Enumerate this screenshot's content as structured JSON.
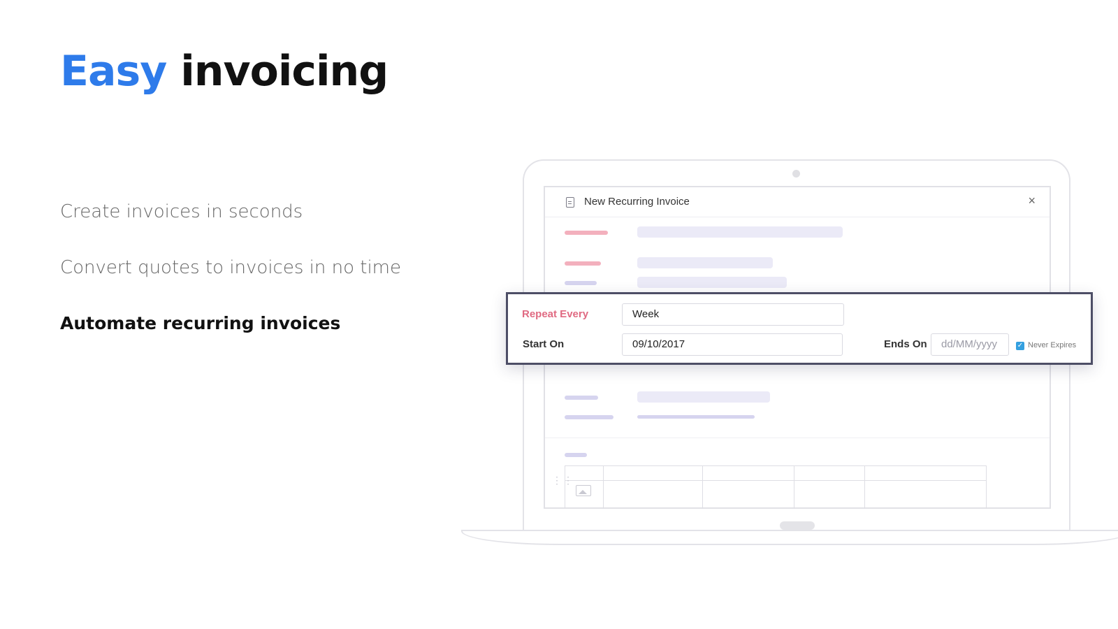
{
  "headline": {
    "accent": "Easy",
    "rest": "invoicing"
  },
  "features": [
    {
      "label": "Create invoices in seconds",
      "active": false
    },
    {
      "label": "Convert quotes to invoices in no time",
      "active": false
    },
    {
      "label": "Automate recurring invoices",
      "active": true
    }
  ],
  "modal": {
    "title": "New Recurring Invoice",
    "close_icon": "close-icon",
    "doc_icon": "document-icon"
  },
  "recurring": {
    "repeat_every_label": "Repeat Every",
    "repeat_every_value": "Week",
    "start_on_label": "Start On",
    "start_on_value": "09/10/2017",
    "ends_on_label": "Ends On",
    "ends_on_placeholder": "dd/MM/yyyy",
    "never_expires_label": "Never Expires",
    "never_expires_checked": true
  },
  "colors": {
    "accent": "#2e7bea",
    "repeat_label": "#e06a82",
    "panel_border": "#4d4e66",
    "checkbox": "#34a0e0"
  }
}
